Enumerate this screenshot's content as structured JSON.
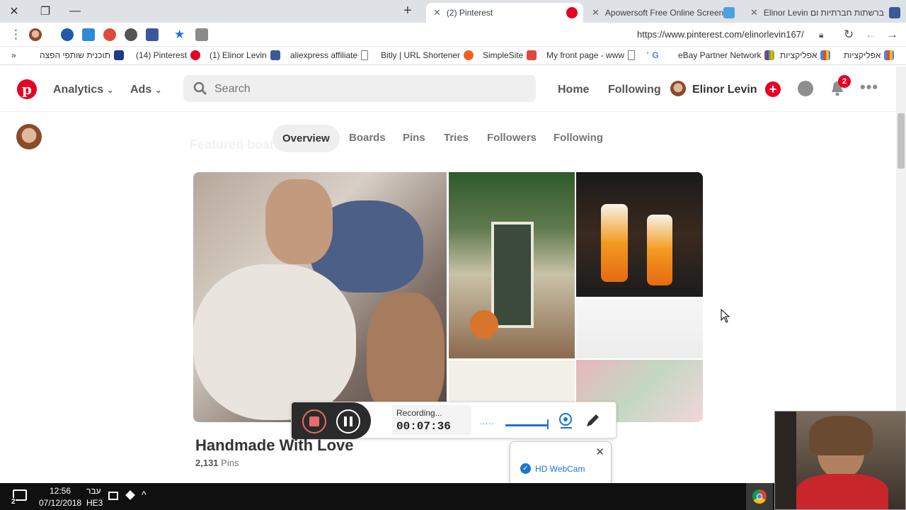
{
  "browser": {
    "tabs": [
      {
        "title": "(2) Pinterest",
        "active": true
      },
      {
        "title": "Apowersoft Free Online Screen R",
        "active": false
      },
      {
        "title": "Elinor Levin ברשתות חברתיות ום",
        "active": false
      }
    ],
    "url": "https://www.pinterest.com/elinorlevin167/",
    "bookmarks": [
      "תוכנית שותפי הפצה",
      "(14) Pinterest",
      "(1) Elinor Levin",
      "aliexpress affiliate",
      "Bitly | URL Shortener",
      "SimpleSite",
      "My front page - www",
      "'",
      "eBay Partner Network",
      "אפליקציות",
      "אפליקציות"
    ],
    "bookmarks_overflow": "»"
  },
  "pinterest": {
    "nav": {
      "analytics": "Analytics",
      "ads": "Ads",
      "search_placeholder": "Search",
      "home": "Home",
      "following": "Following",
      "user": "Elinor Levin",
      "notifications_count": "2"
    },
    "profile_tabs": [
      "Overview",
      "Boards",
      "Pins",
      "Tries",
      "Followers",
      "Following"
    ],
    "ghost_heading": "Featured boards",
    "board": {
      "title": "Handmade With Love",
      "pin_count": "2,131",
      "pin_unit": "Pins"
    }
  },
  "recorder": {
    "status": "Recording...",
    "time": "00:07:36",
    "dots": ".....",
    "popup_option": "HD WebCam"
  },
  "taskbar": {
    "time": "12:56",
    "date": "07/12/2018",
    "lang": "עבר",
    "layout": "HE3",
    "notif_count": "2"
  }
}
